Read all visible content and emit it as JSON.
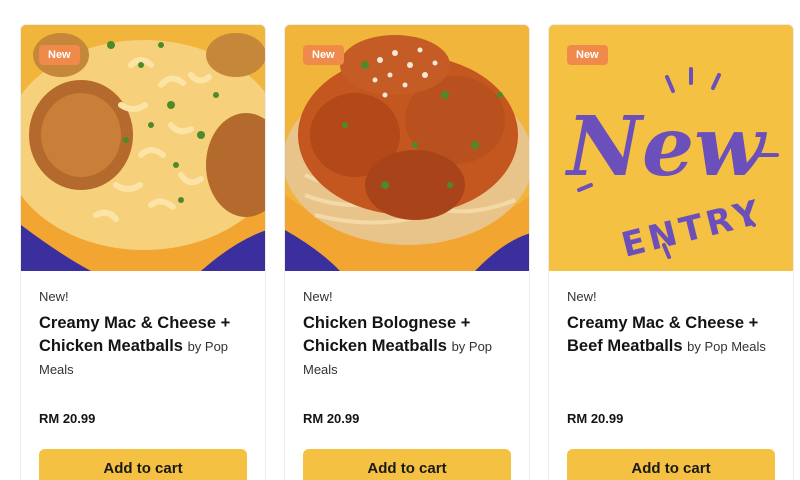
{
  "products": [
    {
      "badge": "New",
      "eyebrow": "New!",
      "title_line1": "Creamy Mac & Cheese +",
      "title_line2": "Chicken Meatballs",
      "by_text": "by Pop Meals",
      "price": "RM 20.99",
      "button": "Add to cart"
    },
    {
      "badge": "New",
      "eyebrow": "New!",
      "title_line1": "Chicken Bolognese +",
      "title_line2": "Chicken Meatballs",
      "by_text": "by Pop Meals",
      "price": "RM 20.99",
      "button": "Add to cart"
    },
    {
      "badge": "New",
      "eyebrow": "New!",
      "title_line1": "Creamy Mac & Cheese +",
      "title_line2": "Beef Meatballs",
      "by_text": "by Pop Meals",
      "price": "RM 20.99",
      "button": "Add to cart"
    }
  ],
  "graphic": {
    "new_word": "New",
    "entry_word": "ENTRY"
  },
  "colors": {
    "accent_yellow": "#f5c142",
    "badge_orange": "#f08a4b",
    "graphic_purple": "#6b4fbb",
    "bowl_blue": "#3b2f9e"
  }
}
